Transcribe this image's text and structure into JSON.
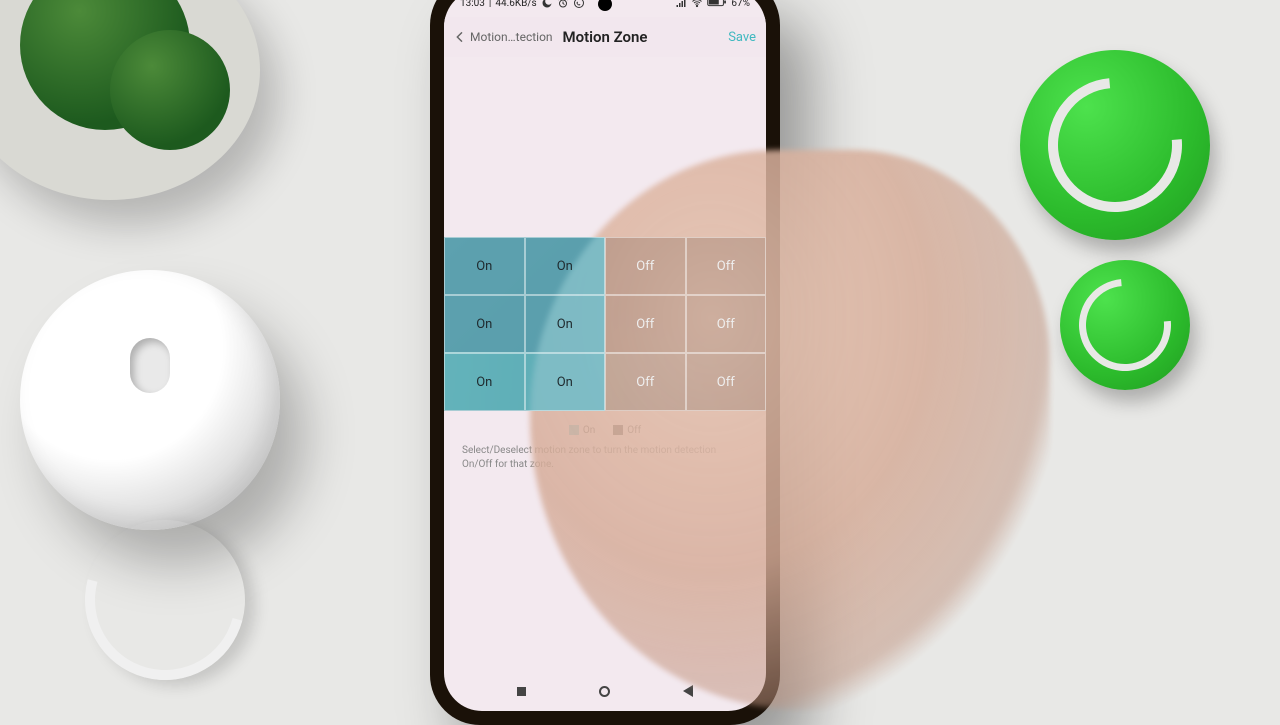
{
  "statusbar": {
    "time": "13:03",
    "net_speed": "44.6KB/s",
    "battery_pct": "67%"
  },
  "header": {
    "back_label": "Motion…tection",
    "title": "Motion Zone",
    "save_label": "Save"
  },
  "zone_grid": {
    "on_label": "On",
    "off_label": "Off",
    "cells": [
      [
        "On",
        "On",
        "Off",
        "Off"
      ],
      [
        "On",
        "On",
        "Off",
        "Off"
      ],
      [
        "On",
        "On",
        "Off",
        "Off"
      ]
    ]
  },
  "legend": {
    "on": "On",
    "off": "Off"
  },
  "help_text": "Select/Deselect motion zone to turn the motion detection On/Off for that zone."
}
